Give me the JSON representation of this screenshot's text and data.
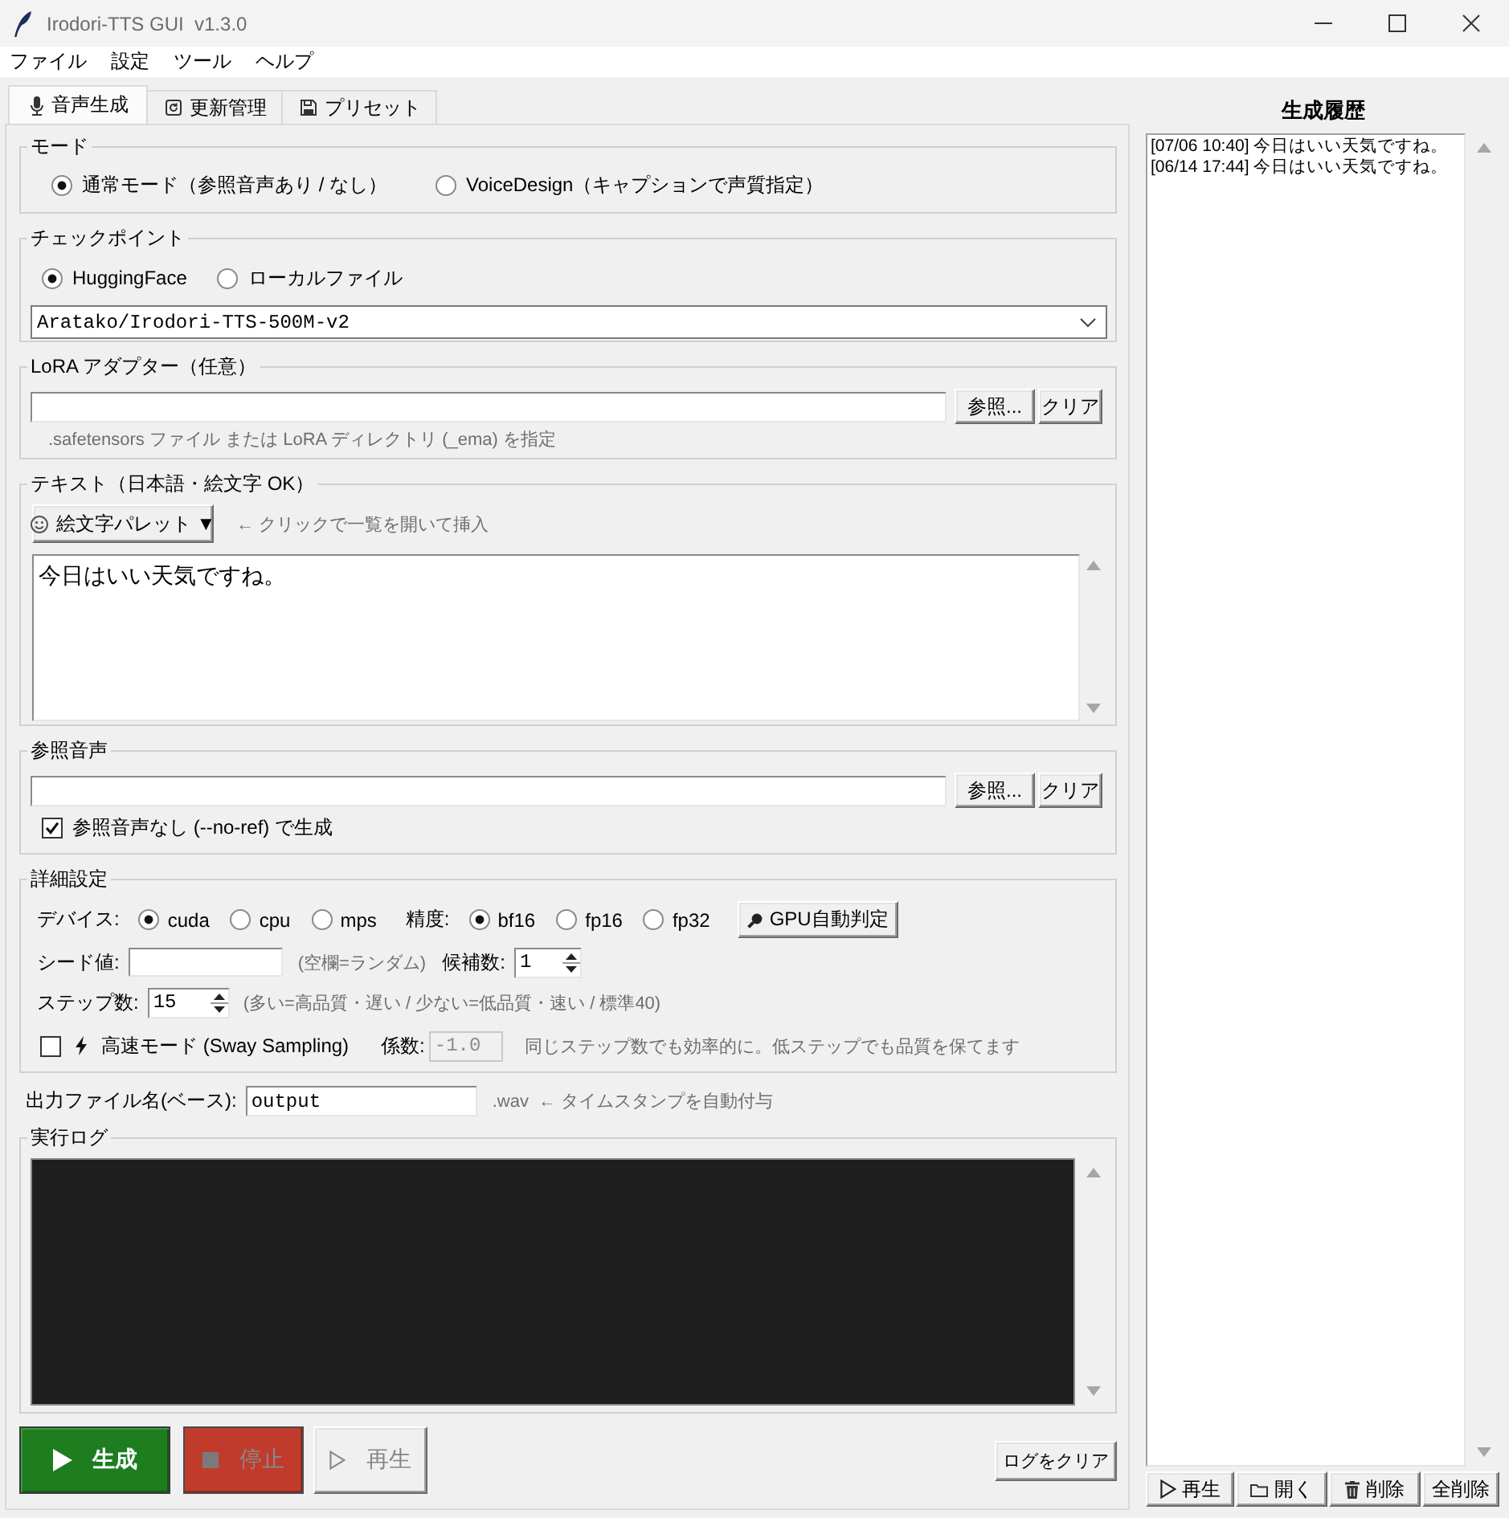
{
  "window": {
    "title": "Irodori-TTS GUI  v1.3.0"
  },
  "menu": [
    "ファイル",
    "設定",
    "ツール",
    "ヘルプ"
  ],
  "tabs": [
    {
      "kind": "voice",
      "label": "音声生成",
      "selected": true
    },
    {
      "kind": "update",
      "label": "更新管理",
      "selected": false
    },
    {
      "kind": "preset",
      "label": "プリセット",
      "selected": false
    }
  ],
  "mode": {
    "title": "モード",
    "options": [
      {
        "label": "通常モード（参照音声あり / なし）",
        "selected": true
      },
      {
        "label": "VoiceDesign（キャプションで声質指定）",
        "selected": false
      }
    ]
  },
  "checkpoint": {
    "title": "チェックポイント",
    "options": [
      {
        "label": "HuggingFace",
        "selected": true
      },
      {
        "label": "ローカルファイル",
        "selected": false
      }
    ],
    "model": "Aratako/Irodori-TTS-500M-v2"
  },
  "lora": {
    "title": "LoRA アダプター（任意）",
    "browse": "参照...",
    "clear": "クリア",
    "hint": ".safetensors ファイル または LoRA ディレクトリ (_ema) を指定"
  },
  "text": {
    "title": "テキスト（日本語・絵文字 OK）",
    "palette_button": "絵文字パレット ▼",
    "palette_hint": "← クリックで一覧を開いて挿入",
    "value": "今日はいい天気ですね。"
  },
  "reference": {
    "title": "参照音声",
    "browse": "参照...",
    "clear": "クリア",
    "no_ref": {
      "label": "参照音声なし (--no-ref) で生成",
      "checked": true
    }
  },
  "advanced": {
    "title": "詳細設定",
    "device_label": "デバイス:",
    "devices": [
      {
        "label": "cuda",
        "selected": true
      },
      {
        "label": "cpu",
        "selected": false
      },
      {
        "label": "mps",
        "selected": false
      }
    ],
    "precision_label": "精度:",
    "precisions": [
      {
        "label": "bf16",
        "selected": true
      },
      {
        "label": "fp16",
        "selected": false
      },
      {
        "label": "fp32",
        "selected": false
      }
    ],
    "gpu_button": "GPU自動判定",
    "seed_label": "シード値:",
    "seed_hint": "(空欄=ランダム)",
    "candidates_label": "候補数:",
    "candidates": "1",
    "steps_label": "ステップ数:",
    "steps": "15",
    "steps_hint": "(多い=高品質・遅い / 少ない=低品質・速い / 標準40)",
    "fast_mode": {
      "label": "高速モード (Sway Sampling)",
      "checked": false
    },
    "coef_label": "係数:",
    "coef": {
      "value": "-1.0",
      "disabled": true
    },
    "fast_hint": "同じステップ数でも効率的に。低ステップでも品質を保てます"
  },
  "output": {
    "label": "出力ファイル名(ベース):",
    "value": "output",
    "extension": ".wav",
    "hint": "← タイムスタンプを自動付与"
  },
  "log": {
    "title": "実行ログ"
  },
  "actions": [
    {
      "kind": "generate",
      "label": "生成",
      "disabled": false
    },
    {
      "kind": "stop",
      "label": "停止",
      "disabled": true
    },
    {
      "kind": "play",
      "label": "再生",
      "disabled": true
    }
  ],
  "clear_log": "ログをクリア",
  "history": {
    "title": "生成履歴",
    "items": [
      {
        "text": "[07/06 10:40] 今日はいい天気ですね。",
        "selected": false
      },
      {
        "text": "[06/14 17:44] 今日はいい天気ですね。",
        "selected": false
      }
    ],
    "buttons": [
      {
        "kind": "play",
        "label": "再生"
      },
      {
        "kind": "open",
        "label": "開く"
      },
      {
        "kind": "delete",
        "label": "削除"
      },
      {
        "kind": "clear",
        "label": "全削除"
      }
    ]
  }
}
